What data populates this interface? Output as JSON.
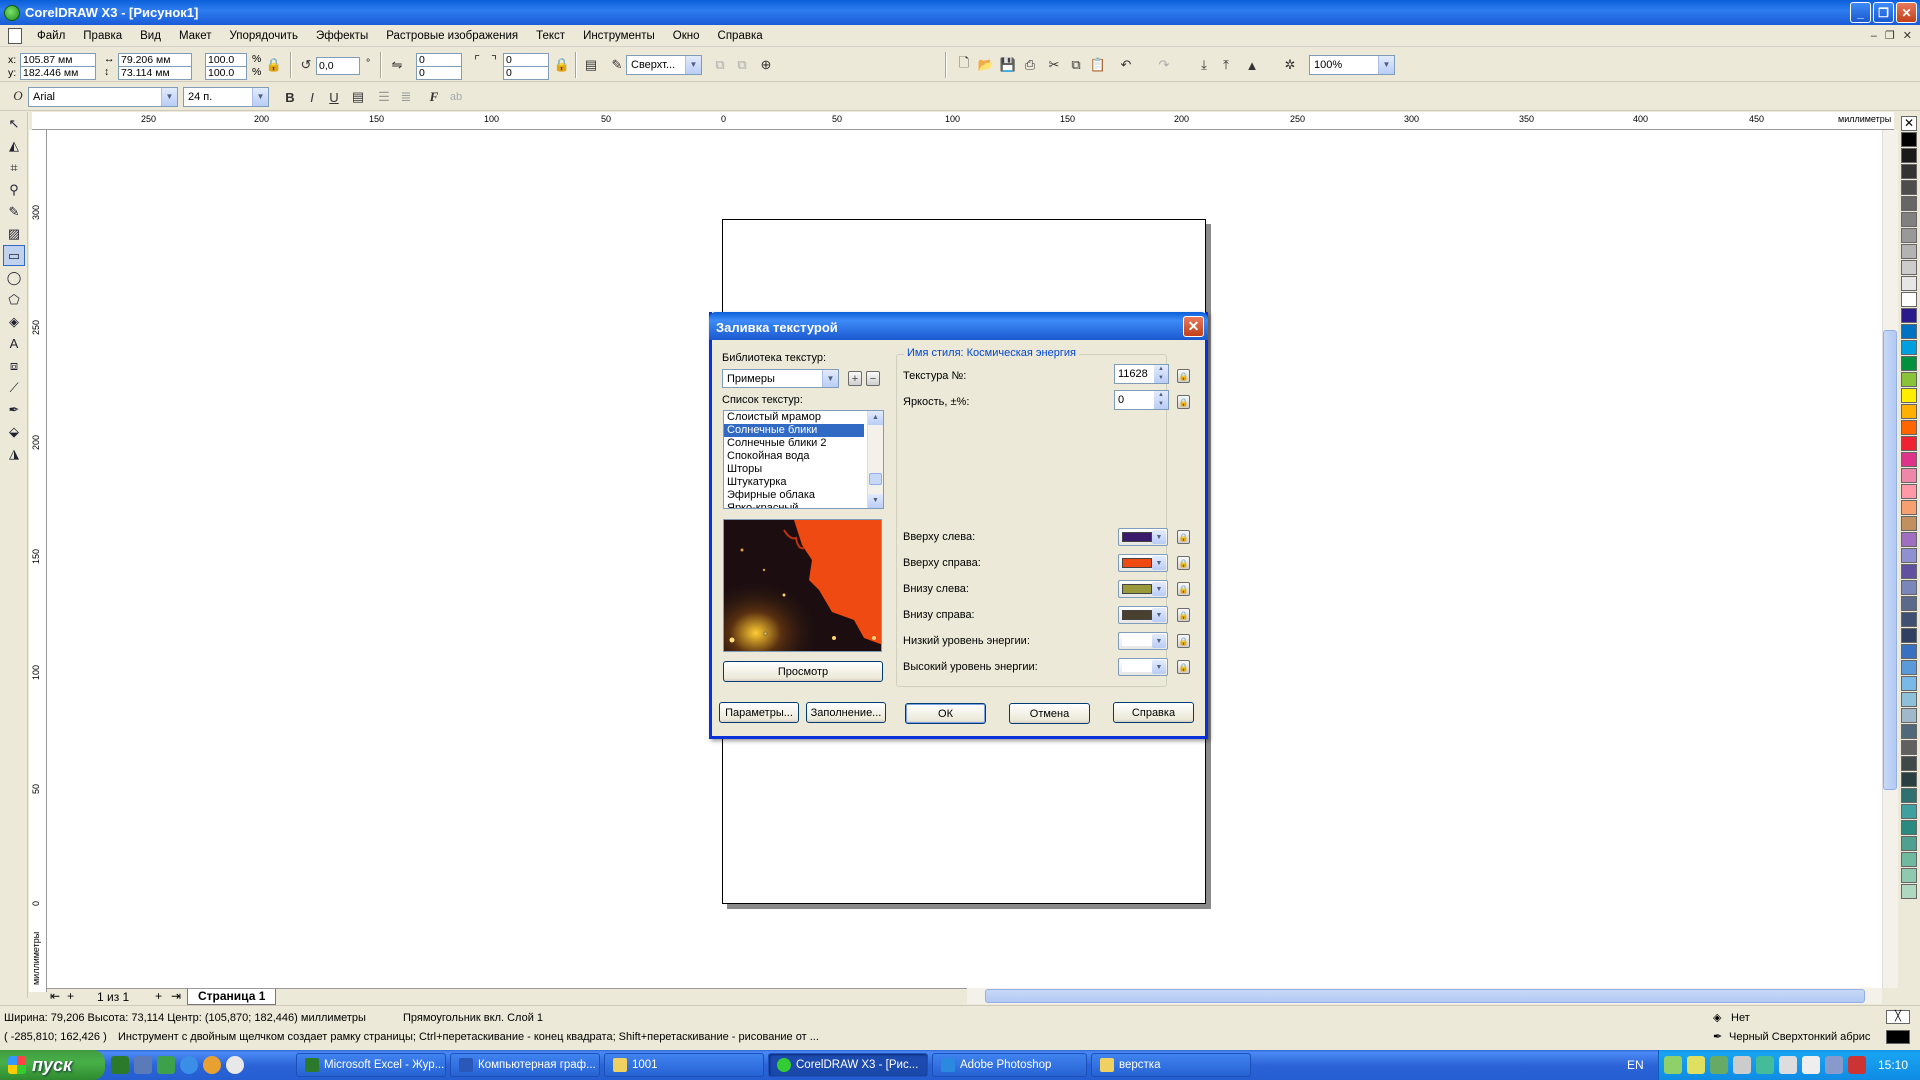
{
  "window": {
    "title": "CorelDRAW X3 - [Рисунок1]"
  },
  "menu": [
    "Файл",
    "Правка",
    "Вид",
    "Макет",
    "Упорядочить",
    "Эффекты",
    "Растровые изображения",
    "Текст",
    "Инструменты",
    "Окно",
    "Справка"
  ],
  "propbar": {
    "x": "105.87 мм",
    "y": "182.446 мм",
    "width": "79.206 мм",
    "height": "73.114 мм",
    "scale_w": "100.0",
    "scale_h": "100.0",
    "pct": "%",
    "rotation": "0,0",
    "deg": "°",
    "corner1": "0",
    "corner2": "0",
    "corner3": "0",
    "corner4": "0",
    "wrap_mode": "Сверхт...",
    "zoom": "100%"
  },
  "textbar": {
    "font": "Arial",
    "size": "24 п."
  },
  "hruler_labels": [
    "250",
    "200",
    "150",
    "100",
    "50",
    "0",
    "50",
    "100",
    "150",
    "200",
    "250",
    "300",
    "350",
    "400",
    "450"
  ],
  "hruler_unit": "миллиметры",
  "vruler_labels": [
    "300",
    "250",
    "200",
    "150",
    "100",
    "50",
    "0"
  ],
  "vruler_unit": "миллиметры",
  "pagebar": {
    "count": "1 из 1",
    "tab": "Страница 1"
  },
  "status": {
    "line1": "Ширина: 79,206  Высота: 73,114  Центр: (105,870; 182,446)  миллиметры",
    "layer": "Прямоугольник вкл. Слой 1",
    "line2": "( -285,810; 162,426 )",
    "hint": "Инструмент с двойным щелчком создает рамку страницы; Ctrl+перетаскивание - конец квадрата; Shift+перетаскивание - рисование от ...",
    "fill": "Нет",
    "outline": "Черный  Сверхтонкий абрис"
  },
  "taskbar": {
    "start": "пуск",
    "tasks": [
      "Microsoft Excel - Жур...",
      "Компьютерная граф...",
      "1001",
      "CorelDRAW X3 - [Рис...",
      "Adobe Photoshop",
      "верстка"
    ],
    "lang": "EN",
    "time": "15:10"
  },
  "dialog": {
    "title": "Заливка текстурой",
    "library_label": "Библиотека текстур:",
    "library_value": "Примеры",
    "list_label": "Список текстур:",
    "textures": [
      "Слоистый мрамор",
      "Солнечные блики",
      "Солнечные блики 2",
      "Спокойная вода",
      "Шторы",
      "Штукатурка",
      "Эфирные облака",
      "Ярко-красный"
    ],
    "selected_index": 1,
    "preview_button": "Просмотр",
    "style_name": "Имя стиля: Космическая энергия",
    "texture_no_label": "Текстура №:",
    "texture_no": "11628",
    "brightness_label": "Яркость, ±%:",
    "brightness": "0",
    "colors": [
      {
        "label": "Вверху слева:",
        "color": "#3a1a6b"
      },
      {
        "label": "Вверху справа:",
        "color": "#ef4a12"
      },
      {
        "label": "Внизу слева:",
        "color": "#9a9a3a"
      },
      {
        "label": "Внизу справа:",
        "color": "#4a4030"
      },
      {
        "label": "Низкий уровень энергии:",
        "color": "#ffffff"
      },
      {
        "label": "Высокий уровень энергии:",
        "color": "#ffffff"
      }
    ],
    "buttons": {
      "params": "Параметры...",
      "tiling": "Заполнение...",
      "ok": "ОК",
      "cancel": "Отмена",
      "help": "Справка"
    }
  },
  "palette": [
    "#000000",
    "#1a1a1a",
    "#333333",
    "#4d4d4d",
    "#666666",
    "#808080",
    "#999999",
    "#b3b3b3",
    "#cccccc",
    "#e6e6e6",
    "#ffffff",
    "#2a1a8a",
    "#0070c0",
    "#00a0e0",
    "#009040",
    "#8ac33a",
    "#ffee00",
    "#ffb000",
    "#ff6600",
    "#ee2233",
    "#dd3388",
    "#ee88aa",
    "#ff99aa",
    "#f4a070",
    "#c09060",
    "#a070c0",
    "#9090d0",
    "#6050a0",
    "#7a86b8",
    "#5a6a88",
    "#405070",
    "#304060",
    "#3a70c0",
    "#5a9ad8",
    "#7ab8e8",
    "#90c0d8",
    "#a0b8c8",
    "#506878",
    "#606060",
    "#404848",
    "#2a4040",
    "#307070",
    "#40a0a0",
    "#2a8a80",
    "#50a090",
    "#70b8a0",
    "#90c8b0",
    "#b0d8c0"
  ]
}
